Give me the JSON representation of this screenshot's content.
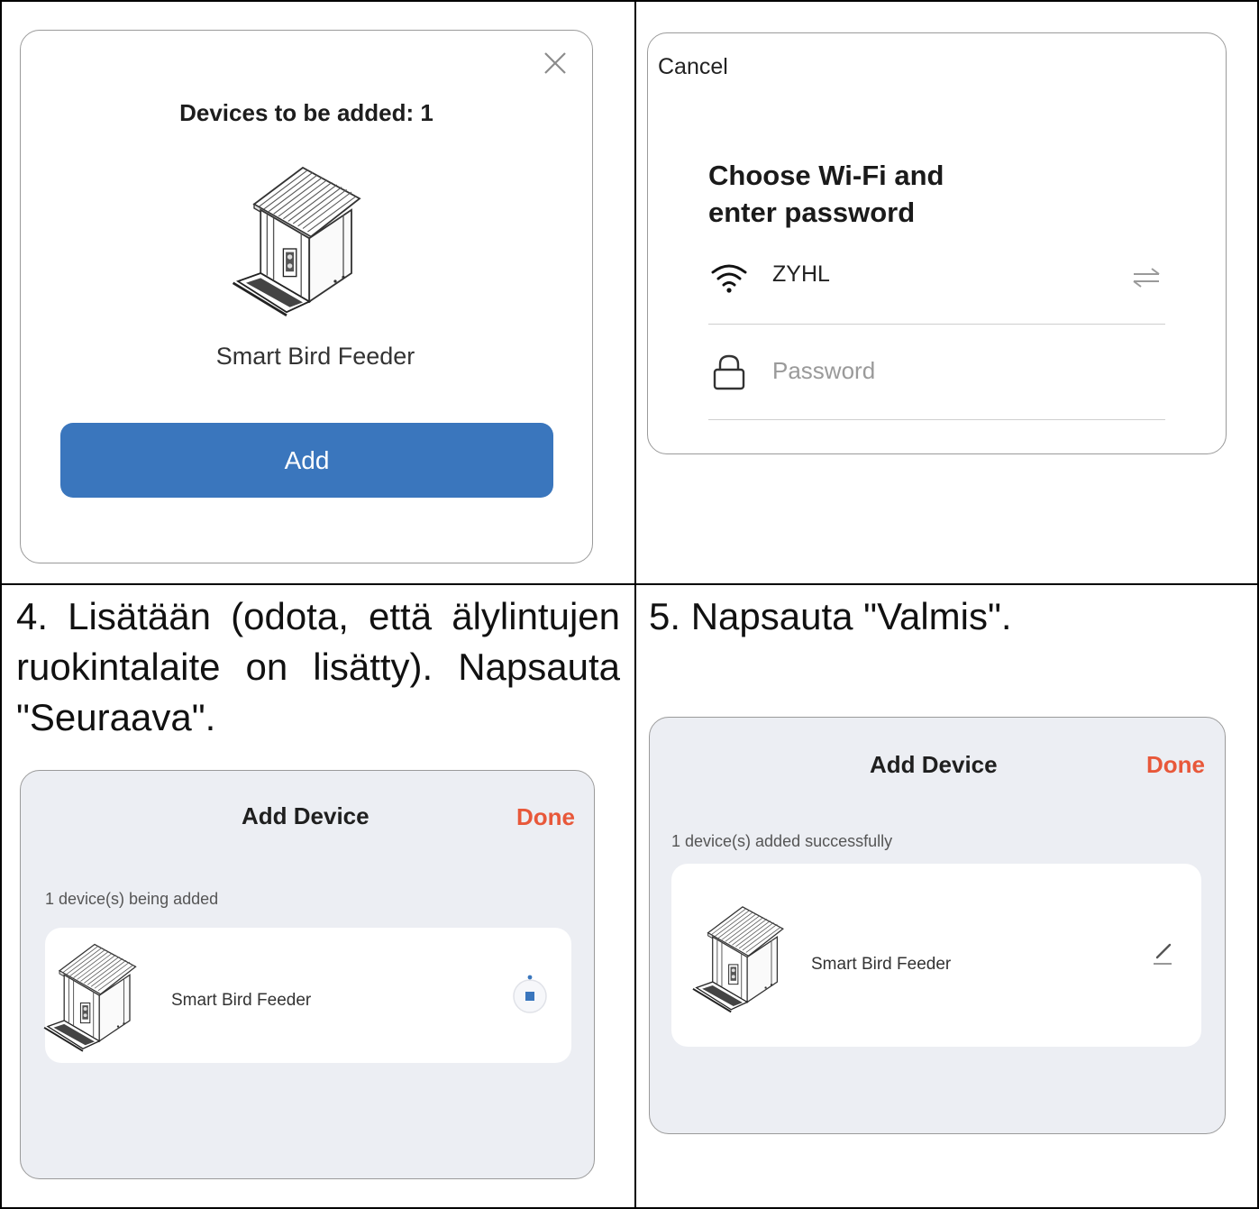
{
  "panel1": {
    "title": "Devices to be added: 1",
    "device_name": "Smart Bird Feeder",
    "add_label": "Add",
    "close_icon": "close-icon",
    "device_icon": "bird-feeder-icon"
  },
  "panel2": {
    "cancel_label": "Cancel",
    "title_line1": "Choose Wi-Fi and",
    "title_line2": "enter password",
    "ssid": "ZYHL",
    "password_placeholder": "Password",
    "icons": [
      "wifi-icon",
      "switch-network-icon",
      "lock-icon"
    ]
  },
  "step4": {
    "text": "4. Lisätään (odota, että älylintujen ruokintalaite on lisätty). Napsauta \"Seuraava\"."
  },
  "step5": {
    "text": "5. Napsauta \"Valmis\"."
  },
  "panel4": {
    "title": "Add Device",
    "done_label": "Done",
    "status": "1 device(s) being added",
    "device_name": "Smart Bird Feeder",
    "accent": "#3a76bd"
  },
  "panel5": {
    "title": "Add Device",
    "done_label": "Done",
    "status": "1 device(s) added successfully",
    "device_name": "Smart Bird Feeder",
    "edit_icon": "edit-pencil-icon"
  },
  "colors": {
    "primary_blue": "#3a76bd",
    "done_orange": "#e8583a",
    "panel_grey": "#eceef3"
  }
}
